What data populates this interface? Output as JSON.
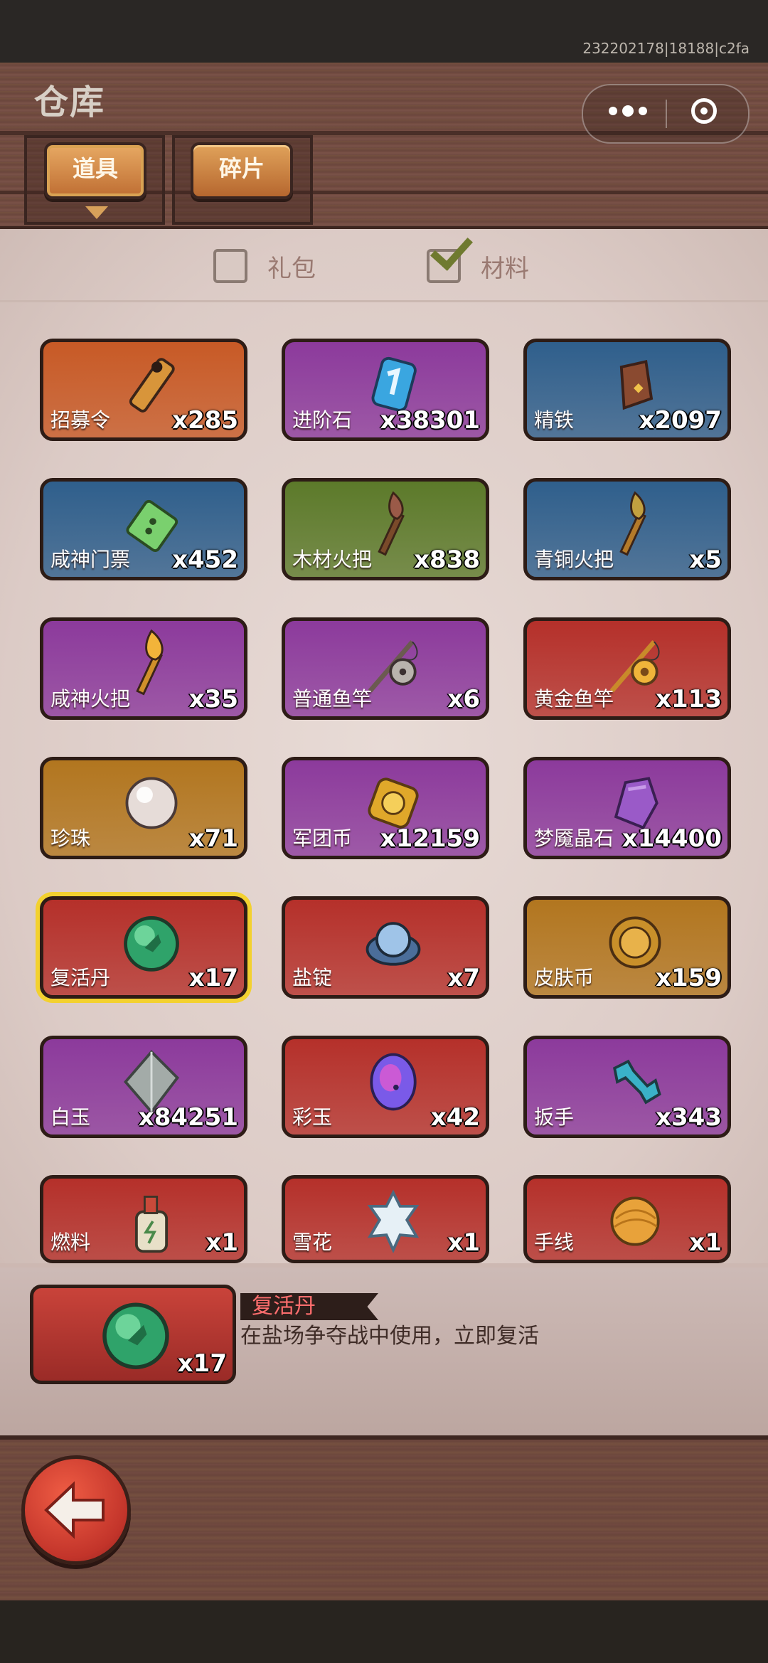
{
  "build_id": "232202178|18188|c2fa",
  "title": "仓库",
  "tabs": [
    {
      "label": "道具",
      "active": true
    },
    {
      "label": "碎片",
      "active": false
    }
  ],
  "filters": [
    {
      "label": "礼包",
      "checked": false
    },
    {
      "label": "材料",
      "checked": true
    }
  ],
  "items": [
    {
      "name": "招募令",
      "count": "x285",
      "rarity": "orange",
      "icon": "coffin-token-icon"
    },
    {
      "name": "进阶石",
      "count": "x38301",
      "rarity": "purple",
      "icon": "rune-stone-icon"
    },
    {
      "name": "精铁",
      "count": "x2097",
      "rarity": "blue",
      "icon": "iron-ingot-icon"
    },
    {
      "name": "咸神门票",
      "count": "x452",
      "rarity": "blue",
      "icon": "ticket-icon"
    },
    {
      "name": "木材火把",
      "count": "x838",
      "rarity": "green",
      "icon": "wood-torch-icon"
    },
    {
      "name": "青铜火把",
      "count": "x5",
      "rarity": "blue",
      "icon": "bronze-torch-icon"
    },
    {
      "name": "咸神火把",
      "count": "x35",
      "rarity": "purple",
      "icon": "golden-torch-icon"
    },
    {
      "name": "普通鱼竿",
      "count": "x6",
      "rarity": "purple",
      "icon": "fishing-rod-icon"
    },
    {
      "name": "黄金鱼竿",
      "count": "x113",
      "rarity": "red",
      "icon": "golden-rod-icon"
    },
    {
      "name": "珍珠",
      "count": "x71",
      "rarity": "gold",
      "icon": "pearl-icon"
    },
    {
      "name": "军团币",
      "count": "x12159",
      "rarity": "purple",
      "icon": "legion-coin-icon"
    },
    {
      "name": "梦魇晶石",
      "count": "x14400",
      "rarity": "purple",
      "icon": "crystal-icon"
    },
    {
      "name": "复活丹",
      "count": "x17",
      "rarity": "red",
      "icon": "revive-pill-icon",
      "selected": true
    },
    {
      "name": "盐锭",
      "count": "x7",
      "rarity": "red",
      "icon": "salt-ingot-icon"
    },
    {
      "name": "皮肤币",
      "count": "x159",
      "rarity": "gold",
      "icon": "skin-coin-icon"
    },
    {
      "name": "白玉",
      "count": "x84251",
      "rarity": "purple",
      "icon": "white-jade-icon"
    },
    {
      "name": "彩玉",
      "count": "x42",
      "rarity": "red",
      "icon": "color-jade-icon"
    },
    {
      "name": "扳手",
      "count": "x343",
      "rarity": "purple",
      "icon": "wrench-icon"
    },
    {
      "name": "燃料",
      "count": "x1",
      "rarity": "red",
      "icon": "fuel-bottle-icon"
    },
    {
      "name": "雪花",
      "count": "x1",
      "rarity": "red",
      "icon": "snowflake-icon"
    },
    {
      "name": "手线",
      "count": "x1",
      "rarity": "red",
      "icon": "yarn-ball-icon"
    }
  ],
  "detail": {
    "name": "复活丹",
    "count": "x17",
    "description": "在盐场争夺战中使用，立即复活",
    "icon": "revive-pill-icon"
  },
  "colors": {
    "orange": "#c85a26",
    "purple": "#8c3a9c",
    "blue": "#2f5f8c",
    "green": "#5c7a2a",
    "red": "#b5302a",
    "gold": "#b2761f",
    "selected_border": "#f3d12f"
  }
}
